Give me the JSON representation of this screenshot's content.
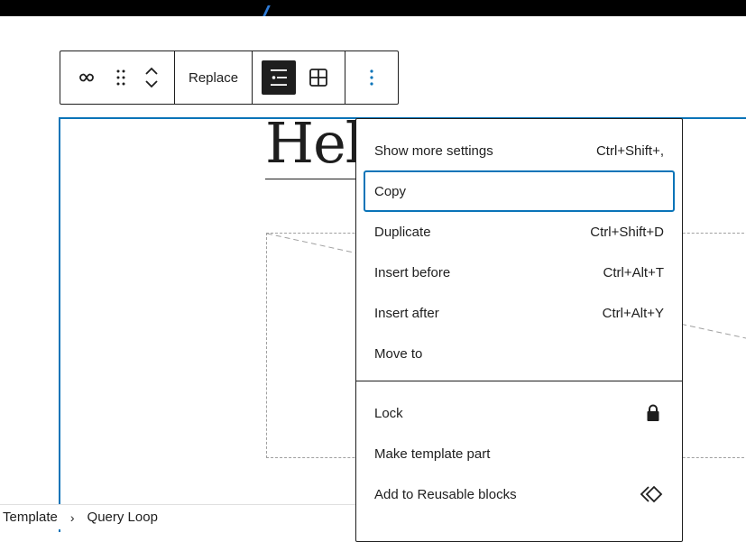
{
  "toolbar": {
    "replace_label": "Replace"
  },
  "canvas": {
    "post_title": "Hell"
  },
  "menu": {
    "group1": [
      {
        "label": "Show more settings",
        "shortcut": "Ctrl+Shift+,"
      },
      {
        "label": "Copy",
        "shortcut": ""
      },
      {
        "label": "Duplicate",
        "shortcut": "Ctrl+Shift+D"
      },
      {
        "label": "Insert before",
        "shortcut": "Ctrl+Alt+T"
      },
      {
        "label": "Insert after",
        "shortcut": "Ctrl+Alt+Y"
      },
      {
        "label": "Move to",
        "shortcut": ""
      }
    ],
    "group2": [
      {
        "label": "Lock",
        "icon": "lock-icon"
      },
      {
        "label": "Make template part",
        "icon": ""
      },
      {
        "label": "Add to Reusable blocks",
        "icon": "reusable-block-icon"
      }
    ]
  },
  "breadcrumb": {
    "items": [
      "Template",
      "Query Loop"
    ],
    "separator": "›"
  },
  "colors": {
    "accent": "#0a74b8",
    "dark": "#1e1e1e"
  }
}
